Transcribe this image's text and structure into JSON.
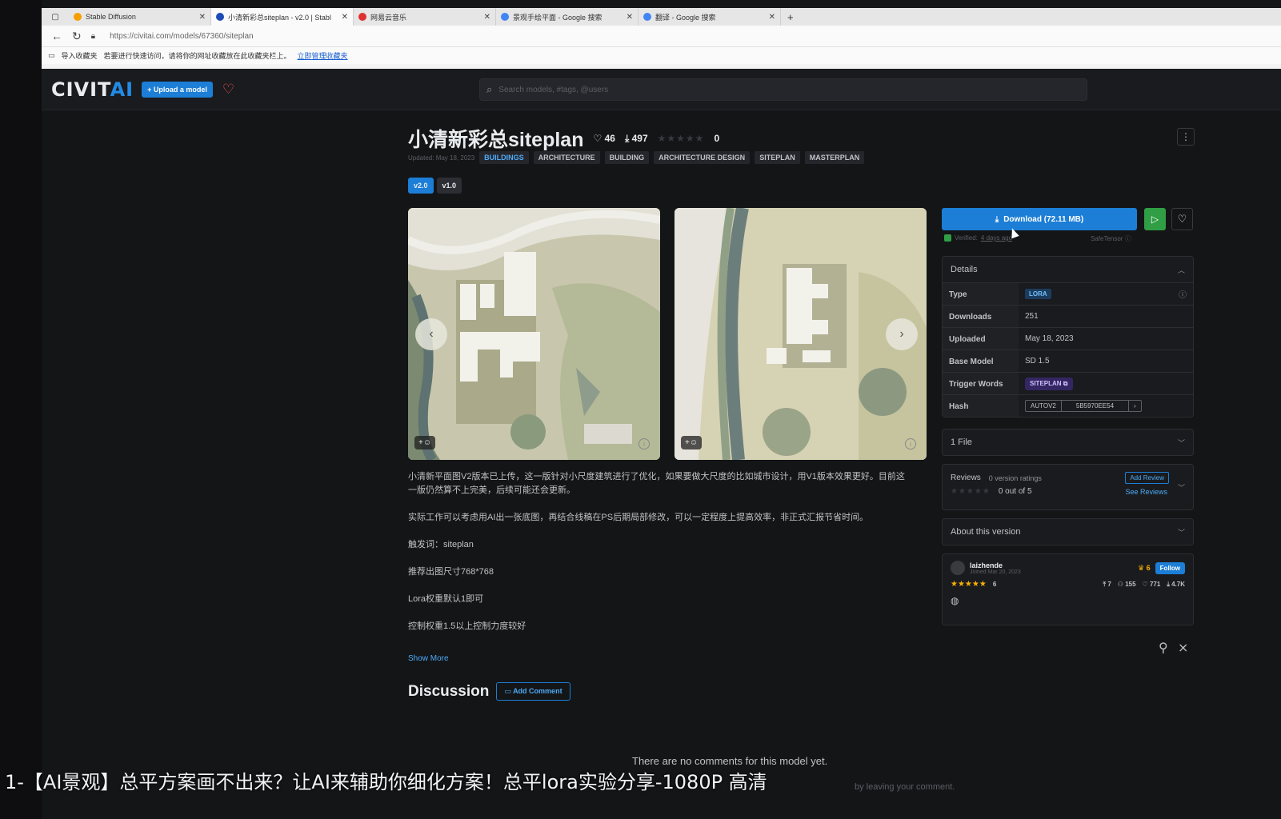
{
  "browser": {
    "tabs": [
      {
        "title": "Stable Diffusion",
        "color": "#f59f00"
      },
      {
        "title": "小清新彩总siteplan - v2.0 | Stabl",
        "color": "#1c4bb6"
      },
      {
        "title": "网易云音乐",
        "color": "#e03131"
      },
      {
        "title": "景观手绘平面 - Google 搜索",
        "color": "#4285f4"
      },
      {
        "title": "翻译 - Google 搜索",
        "color": "#4285f4"
      }
    ],
    "url": "https://civitai.com/models/67360/siteplan",
    "fav_import": "导入收藏夹",
    "fav_hint": "若要进行快速访问，请将你的网址收藏放在此收藏夹栏上。",
    "fav_link": "立即管理收藏夹"
  },
  "header": {
    "logo_a": "CIVIT",
    "logo_b": "AI",
    "upload_label": "+ Upload a model",
    "search_placeholder": "Search models, #tags, @users"
  },
  "model": {
    "title": "小清新彩总siteplan",
    "likes": "46",
    "downloads": "497",
    "rating_count": "0",
    "updated": "Updated: May 18, 2023",
    "tags": [
      "BUILDINGS",
      "ARCHITECTURE",
      "BUILDING",
      "ARCHITECTURE DESIGN",
      "SITEPLAN",
      "MASTERPLAN"
    ],
    "versions": [
      "v2.0",
      "v1.0"
    ]
  },
  "description": {
    "p1": "小清新平面图V2版本已上传，这一版针对小尺度建筑进行了优化，如果要做大尺度的比如城市设计，用V1版本效果更好。目前这一版仍然算不上完美，后续可能还会更新。",
    "p2": "实际工作可以考虑用AI出一张底图，再结合线稿在PS后期局部修改，可以一定程度上提高效率，非正式汇报节省时间。",
    "p3": "触发词：siteplan",
    "p4": "推荐出图尺寸768*768",
    "p5": "Lora权重默认1即可",
    "p6": "控制权重1.5以上控制力度较好",
    "show_more": "Show More"
  },
  "discussion": {
    "title": "Discussion",
    "add_comment": "Add Comment",
    "empty": "There are no comments for this model yet.",
    "leave": "by leaving your comment."
  },
  "sidebar": {
    "download": "Download (72.11 MB)",
    "verified": "Verified:",
    "verified_when": "4 days ago",
    "safetensor": "SafeTensor",
    "details_title": "Details",
    "details": {
      "type_k": "Type",
      "type_v": "LORA",
      "downloads_k": "Downloads",
      "downloads_v": "251",
      "uploaded_k": "Uploaded",
      "uploaded_v": "May 18, 2023",
      "base_k": "Base Model",
      "base_v": "SD 1.5",
      "trigger_k": "Trigger Words",
      "trigger_v": "SITEPLAN",
      "hash_k": "Hash",
      "hash_type": "AUTOV2",
      "hash_v": "5B5970EE54"
    },
    "files": "1 File",
    "reviews_title": "Reviews",
    "reviews_count": "0 version ratings",
    "add_review": "Add Review",
    "score": "0 out of 5",
    "see_reviews": "See Reviews",
    "about": "About this version",
    "user": {
      "name": "laizhende",
      "joined": "Joined Mar 20, 2023",
      "crowns": "6",
      "follow": "Follow",
      "rating_count": "6",
      "uploads": "7",
      "followers": "155",
      "likes": "771",
      "downloads": "4.7K"
    }
  },
  "subtitle": "1-【AI景观】总平方案画不出来？让AI来辅助你细化方案！总平lora实验分享-1080P 高清"
}
